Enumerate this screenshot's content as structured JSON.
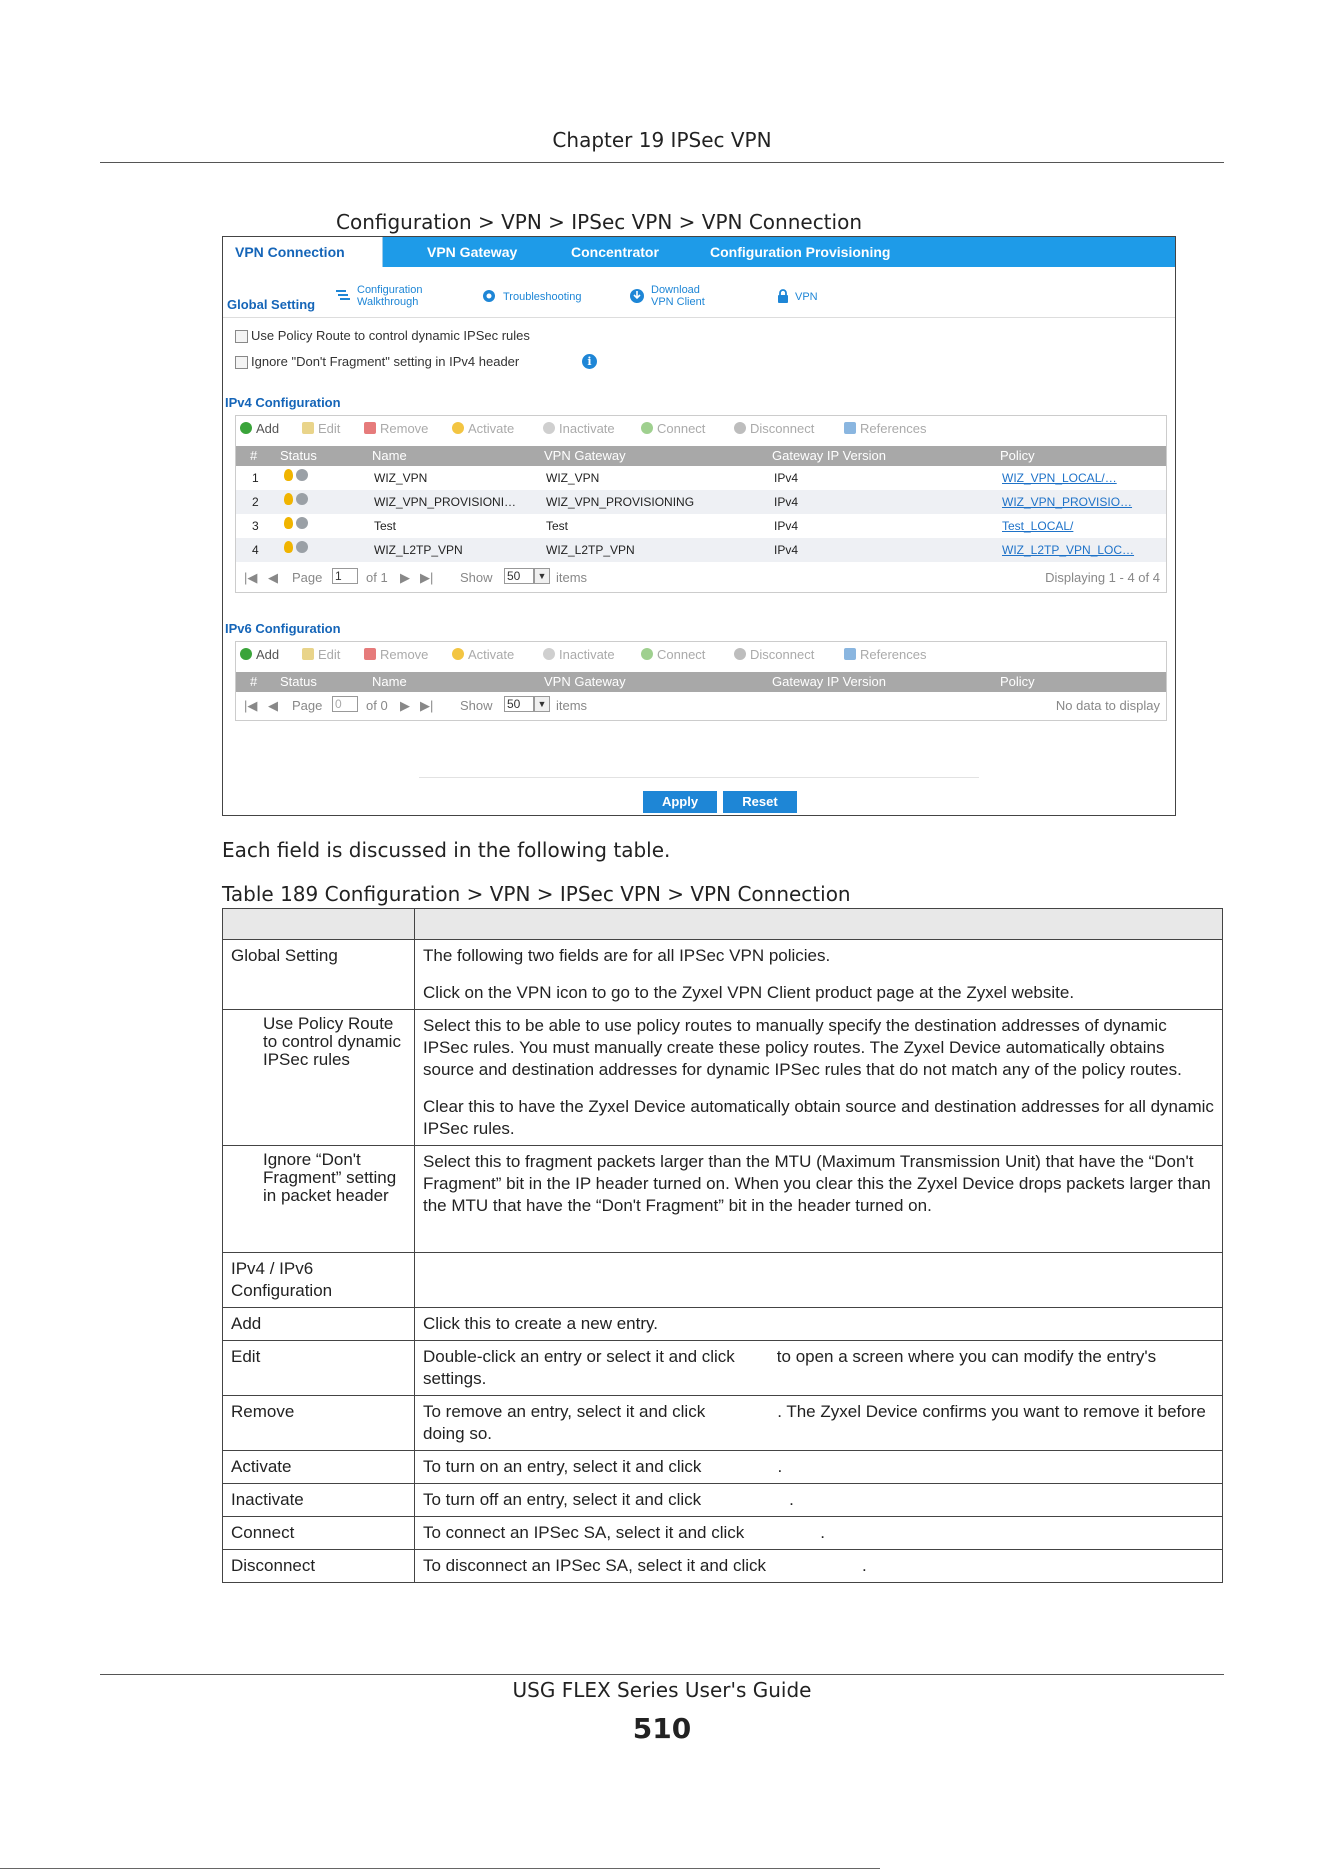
{
  "header": {
    "chapter": "Chapter 19 IPSec VPN"
  },
  "figure": {
    "caption": "Configuration > VPN > IPSec VPN > VPN Connection",
    "tabs": [
      "VPN Connection",
      "VPN Gateway",
      "Concentrator",
      "Configuration Provisioning"
    ],
    "global_setting_label": "Global Setting",
    "tools": {
      "walkthrough_line1": "Configuration",
      "walkthrough_line2": "Walkthrough",
      "troubleshooting": "Troubleshooting",
      "download_line1": "Download",
      "download_line2": "VPN Client",
      "vpn": "VPN"
    },
    "checkboxes": {
      "policy_route": "Use Policy Route to control dynamic IPSec rules",
      "dont_fragment": "Ignore \"Don't Fragment\" setting in IPv4 header"
    },
    "toolbar": {
      "add": "Add",
      "edit": "Edit",
      "remove": "Remove",
      "activate": "Activate",
      "inactivate": "Inactivate",
      "connect": "Connect",
      "disconnect": "Disconnect",
      "references": "References"
    },
    "columns": [
      "#",
      "Status",
      "Name",
      "VPN Gateway",
      "Gateway IP Version",
      "Policy"
    ],
    "ipv4": {
      "title": "IPv4 Configuration",
      "rows": [
        {
          "num": "1",
          "name": "WIZ_VPN",
          "gateway": "WIZ_VPN",
          "ipver": "IPv4",
          "policy": "WIZ_VPN_LOCAL/…"
        },
        {
          "num": "2",
          "name": "WIZ_VPN_PROVISIONI…",
          "gateway": "WIZ_VPN_PROVISIONING",
          "ipver": "IPv4",
          "policy": "WIZ_VPN_PROVISIO…"
        },
        {
          "num": "3",
          "name": "Test",
          "gateway": "Test",
          "ipver": "IPv4",
          "policy": "Test_LOCAL/"
        },
        {
          "num": "4",
          "name": "WIZ_L2TP_VPN",
          "gateway": "WIZ_L2TP_VPN",
          "ipver": "IPv4",
          "policy": "WIZ_L2TP_VPN_LOC…"
        }
      ],
      "pager": {
        "page_label": "Page",
        "page": "1",
        "of": "of 1",
        "show": "Show",
        "per_page": "50",
        "items": "items",
        "status": "Displaying 1 - 4 of 4"
      }
    },
    "ipv6": {
      "title": "IPv6 Configuration",
      "pager": {
        "page_label": "Page",
        "page": "0",
        "of": "of 0",
        "show": "Show",
        "per_page": "50",
        "items": "items",
        "status": "No data to display"
      }
    },
    "apply": "Apply",
    "reset": "Reset"
  },
  "intro": "Each field is discussed in the following table.",
  "table_caption": "Table 189   Configuration > VPN > IPSec VPN > VPN Connection",
  "table": {
    "global_setting": {
      "label": "Global Setting",
      "p1": "The following two fields are for all IPSec VPN policies.",
      "p2": "Click on the VPN icon to go to the Zyxel VPN Client product page at the Zyxel website."
    },
    "policy_route": {
      "label": "Use Policy Route to control dynamic IPSec rules",
      "p1": "Select this to be able to use policy routes to manually specify the destination addresses of dynamic IPSec rules. You must manually create these policy routes. The Zyxel Device automatically obtains source and destination addresses for dynamic IPSec rules that do not match any of the policy routes.",
      "p2": "Clear this to have the Zyxel Device automatically obtain source and destination addresses for all dynamic IPSec rules."
    },
    "dont_fragment": {
      "label": "Ignore “Don't Fragment” setting in packet header",
      "p1": "Select this to fragment packets larger than the MTU (Maximum Transmission Unit) that have the “Don't Fragment” bit in the IP header turned on. When you clear this the Zyxel Device drops packets larger than the MTU that have the “Don't Fragment” bit in the header turned on."
    },
    "ipv46": {
      "label": "IPv4 / IPv6 Configuration"
    },
    "add": {
      "label": "Add",
      "desc": "Click this to create a new entry."
    },
    "edit": {
      "label": "Edit",
      "desc_a": "Double-click an entry or select it and click",
      "desc_b": "to open a screen where you can modify the entry's settings."
    },
    "remove": {
      "label": "Remove",
      "desc_a": "To remove an entry, select it and click",
      "desc_b": ". The Zyxel Device confirms you want to remove it before doing so."
    },
    "activate": {
      "label": "Activate",
      "desc_a": "To turn on an entry, select it and click",
      "desc_b": "."
    },
    "inactivate": {
      "label": "Inactivate",
      "desc_a": "To turn off an entry, select it and click",
      "desc_b": "."
    },
    "connect": {
      "label": "Connect",
      "desc_a": "To connect an IPSec SA, select it and click",
      "desc_b": "."
    },
    "disconnect": {
      "label": "Disconnect",
      "desc_a": "To disconnect an IPSec SA, select it and click",
      "desc_b": "."
    }
  },
  "footer": {
    "guide": "USG FLEX Series User's Guide",
    "page": "510"
  },
  "colors": {
    "tabbar": "#1e9be8",
    "link": "#1565b8",
    "button": "#1e86d6"
  }
}
